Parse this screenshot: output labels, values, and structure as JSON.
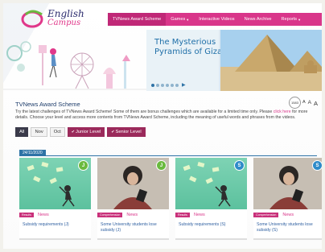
{
  "header": {
    "logo_line1": "English",
    "logo_line2": "Campus",
    "nav": [
      {
        "label": "TVNews Award Scheme",
        "active": true,
        "dropdown": false
      },
      {
        "label": "Games",
        "active": false,
        "dropdown": true
      },
      {
        "label": "Interactive Videos",
        "active": false,
        "dropdown": false
      },
      {
        "label": "News Archive",
        "active": false,
        "dropdown": false
      },
      {
        "label": "Reports",
        "active": false,
        "dropdown": true
      }
    ]
  },
  "banner": {
    "title": "The Mysterious Pyramids of Giza",
    "slide_dots": 6,
    "active_dot": 0
  },
  "section": {
    "title": "TVNews Award Scheme",
    "view_count": "1583",
    "font_sizes": [
      "A",
      "A",
      "A"
    ],
    "description_1": "Try the latest challenges of TVNews Award Scheme! Some of them are bonus challenges which are available for a limited time only. Please ",
    "description_link": "click here",
    "description_2": " for more details. Choose your level and access more contents from TVNews Award Scheme, including the meaning of useful words and phrases from the videos.",
    "filters": [
      "All",
      "Nov",
      "Oct"
    ],
    "levels": [
      "Junior Level",
      "Senior Level"
    ]
  },
  "date_label": "24/11/2020",
  "cards": [
    {
      "badge": "J",
      "tag": "Results",
      "type": "News",
      "title": "Subsidy requirements (J)",
      "thumb": "green"
    },
    {
      "badge": "J",
      "tag": "Comprehension",
      "type": "News",
      "title": "Some University students lose subsidy (J)",
      "thumb": "photo"
    },
    {
      "badge": "S",
      "tag": "Results",
      "type": "News",
      "title": "Subsidy requirements (S)",
      "thumb": "green"
    },
    {
      "badge": "S",
      "tag": "Comprehension",
      "type": "News",
      "title": "Some University students lose subsidy (S)",
      "thumb": "photo"
    }
  ],
  "colors": {
    "accent_pink": "#d9368a",
    "primary_blue": "#2e73a6",
    "junior_badge": "#6aba3f",
    "senior_badge": "#2e8bc9"
  }
}
